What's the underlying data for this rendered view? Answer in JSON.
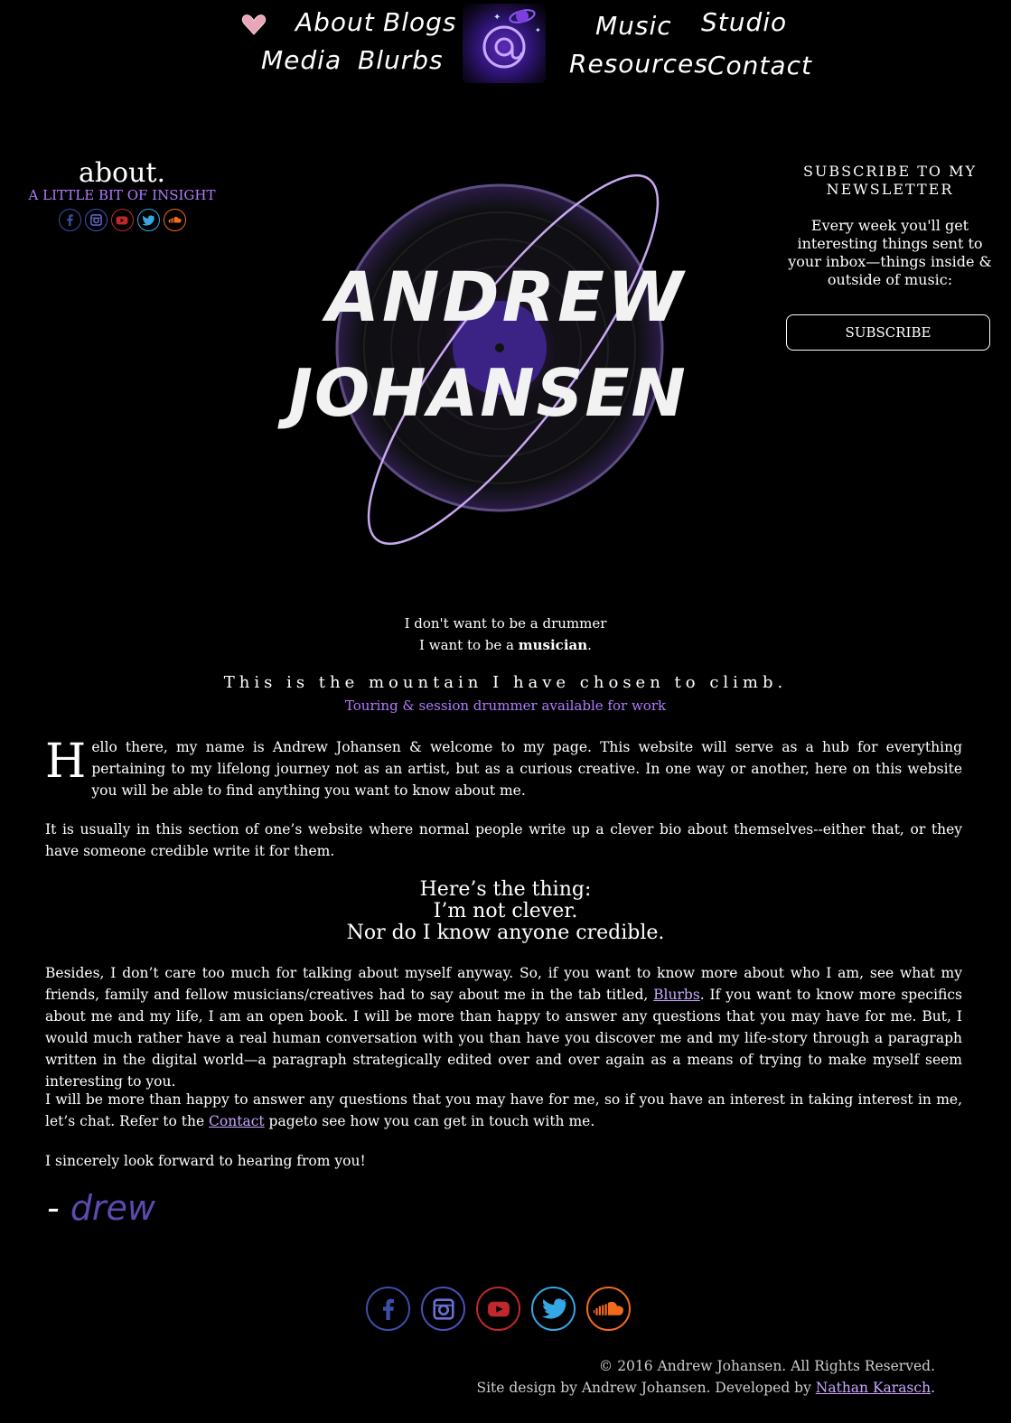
{
  "nav": {
    "left": [
      {
        "label": "About"
      },
      {
        "label": "Blogs"
      },
      {
        "label": "Media"
      },
      {
        "label": "Blurbs"
      }
    ],
    "right": [
      {
        "label": "Music"
      },
      {
        "label": "Studio"
      },
      {
        "label": "Resources"
      },
      {
        "label": "Contact"
      }
    ],
    "logo_text": "@"
  },
  "about": {
    "title": "about.",
    "subtitle": "A LITTLE BIT OF INSIGHT"
  },
  "social_icons": [
    "facebook-icon",
    "instagram-icon",
    "youtube-icon",
    "twitter-icon",
    "soundcloud-icon"
  ],
  "social_colors": {
    "facebook": "#3b4fa8",
    "instagram": "#4a50b8",
    "youtube": "#c0282d",
    "twitter": "#35a7e6",
    "soundcloud": "#f26a1b"
  },
  "newsletter": {
    "heading_1": "SUBSCRIBE TO MY",
    "heading_2": "NEWSLETTER",
    "text": "Every week you'll get interesting things sent to your inbox—things inside & outside of music:",
    "button": "SUBSCRIBE"
  },
  "hero": {
    "line1": "ANDREW",
    "line2": "JOHANSEN"
  },
  "taglines": {
    "line1": "I don't want to be a drummer",
    "line2_pre": "I want to be a ",
    "line2_bold": "musician",
    "line2_post": ".",
    "mountain": "This is the mountain I have chosen to climb.",
    "touring": "Touring & session drummer available for work"
  },
  "body": {
    "dropcap": "H",
    "p1": "ello there, my name is Andrew Johansen & welcome to my page. This website will serve as a hub for everything pertaining to my lifelong journey not as an artist, but as a curious creative. In one way or another, here on this website you will be able to find anything you want to know about me.",
    "p2": "It is usually in this section of one’s website where normal people write up a clever bio about themselves--either that, or they have someone credible write it for them.",
    "big1": "Here’s the thing:",
    "big2": "I’m not clever.",
    "big3": "Nor do I know anyone credible.",
    "p3_a": "Besides, I don’t care too much for talking about myself anyway. So, if you want to know more about who I am, see what my friends, family and fellow musicians/creatives had to say about me in the tab titled, ",
    "p3_link": "Blurbs",
    "p3_b": ". If you want to know more specifics about me and my life, I am an open book. I will be more than happy to answer any questions that you may have for me. But, I would much rather have a real human conversation with you than have you discover me and my life-story through a paragraph written in the digital world—a paragraph strategically edited over and over again as a means of trying to make myself seem interesting to you.",
    "p4_a": "I will be more than happy to answer any questions that you may have for me, so if you have an interest in taking interest in me, let’s chat. Refer to the ",
    "p4_link": "Contact",
    "p4_b": " pageto see how you can get in touch with me.",
    "p5": "I sincerely look forward to hearing from you!",
    "sig_dash": "-",
    "sig_name": "drew"
  },
  "footer": {
    "copyright": "© 2016 Andrew Johansen. All Rights Reserved.",
    "design_pre": "Site design by Andrew Johansen. Developed by ",
    "design_link": "Nathan Karasch",
    "design_post": "."
  }
}
